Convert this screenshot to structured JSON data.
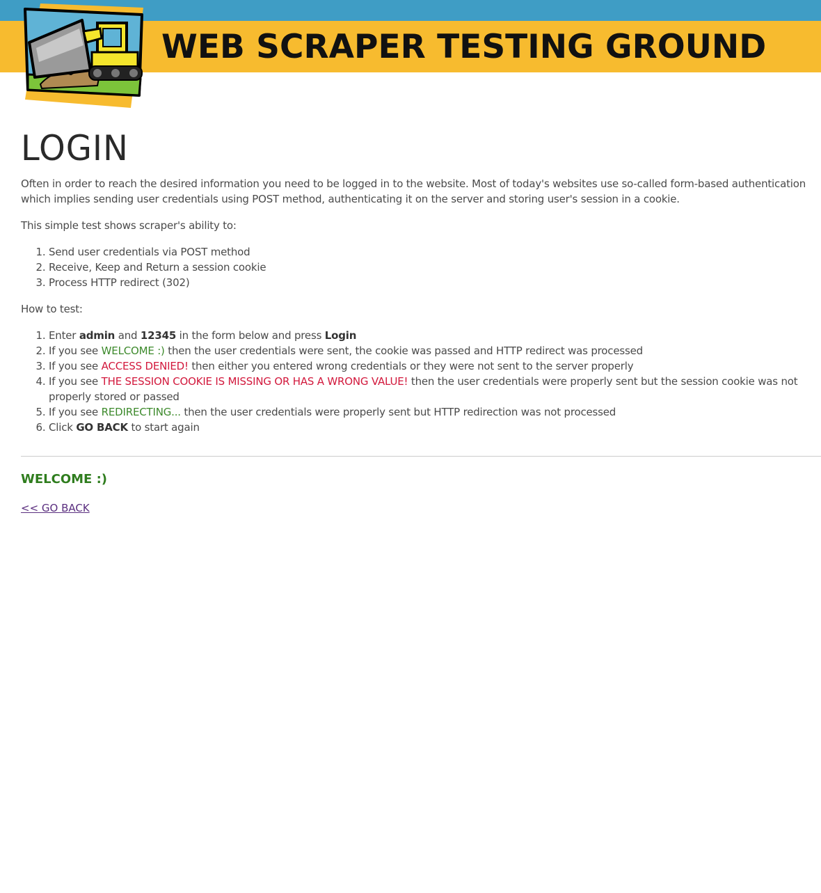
{
  "header": {
    "site_title": "WEB SCRAPER TESTING GROUND",
    "logo_icon": "bulldozer-logo-icon",
    "colors": {
      "top_strip": "#3f9dc5",
      "banner": "#f7bb2f"
    }
  },
  "main": {
    "page_title": "LOGIN",
    "intro": "Often in order to reach the desired information you need to be logged in to the website. Most of today's websites use so-called form-based authentication which implies sending user credentials using POST method, authenticating it on the server and storing user's session in a cookie.",
    "ability_intro": "This simple test shows scraper's ability to:",
    "abilities": [
      "Send user credentials via POST method",
      "Receive, Keep and Return a session cookie",
      "Process HTTP redirect (302)"
    ],
    "howto_intro": "How to test:",
    "steps": {
      "s1": {
        "a": "Enter ",
        "user": "admin",
        "b": " and ",
        "pass": "12345",
        "c": " in the form below and press ",
        "login": "Login"
      },
      "s2": {
        "prefix": "If you see ",
        "highlight": "WELCOME :)",
        "suffix": " then the user credentials were sent, the cookie was passed and HTTP redirect was processed"
      },
      "s3": {
        "prefix": "If you see ",
        "highlight": "ACCESS DENIED!",
        "suffix": " then either you entered wrong credentials or they were not sent to the server properly"
      },
      "s4": {
        "prefix": "If you see ",
        "highlight": "THE SESSION COOKIE IS MISSING OR HAS A WRONG VALUE!",
        "suffix": " then the user credentials were properly sent but the session cookie was not properly stored or passed"
      },
      "s5": {
        "prefix": "If you see ",
        "highlight": "REDIRECTING...",
        "suffix": " then the user credentials were properly sent but HTTP redirection was not processed"
      },
      "s6": {
        "prefix": "Click ",
        "bold": "GO BACK",
        "suffix": " to start again"
      }
    },
    "result": {
      "message": "WELCOME :)",
      "back_link": "<< GO BACK"
    },
    "colors": {
      "green": "#3d8a2c",
      "red": "#d2183c",
      "link": "#5a2e7f"
    }
  }
}
